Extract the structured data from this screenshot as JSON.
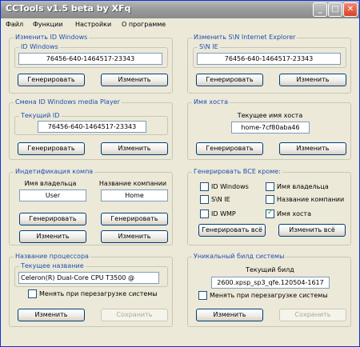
{
  "window": {
    "title": "CCTools v1.5 beta by XFq"
  },
  "titlebar_buttons": {
    "minimize": "_",
    "maximize": "□",
    "close": "✕"
  },
  "menu": [
    "Файл",
    "Функции",
    "Настройки",
    "О программе"
  ],
  "windows_id": {
    "group_title": "Изменить ID Windows",
    "field_label": "ID Windows",
    "value": "76456-640-1464517-23343",
    "generate_label": "Генерировать",
    "change_label": "Изменить"
  },
  "ie": {
    "group_title": "Изменить S\\N Internet Explorer",
    "field_label": "S\\N IE",
    "value": "76456-640-1464517-23343",
    "generate_label": "Генерировать",
    "change_label": "Изменить"
  },
  "media_player": {
    "group_title": "Смена ID Windows media Player",
    "field_label": "Текущий ID",
    "value": "76456-640-1464517-23343",
    "generate_label": "Генерировать",
    "change_label": "Изменить"
  },
  "host": {
    "group_title": "Имя хоста",
    "field_label": "Текущее имя хоста",
    "value": "home-7cf80aba46",
    "generate_label": "Генерировать",
    "change_label": "Изменить"
  },
  "identification": {
    "group_title": "Индетификация компа",
    "owner_label": "Имя владельца",
    "owner_value": "User",
    "company_label": "Название компании",
    "company_value": "Home",
    "generate_owner_label": "Генерировать",
    "change_owner_label": "Изменить",
    "generate_company_label": "Генерировать",
    "change_company_label": "Изменить"
  },
  "generate_all": {
    "group_title": "Генерировать ВСЕ кроме:",
    "options": [
      {
        "label": "ID Windows",
        "checked": false
      },
      {
        "label": "Имя владельца",
        "checked": false
      },
      {
        "label": "S\\N IE",
        "checked": false
      },
      {
        "label": "Название компании",
        "checked": false
      },
      {
        "label": "ID WMP",
        "checked": false
      },
      {
        "label": "Имя хоста",
        "checked": true
      }
    ],
    "generate_all_label": "Генерировать всё",
    "change_all_label": "Изменить всё"
  },
  "processor": {
    "group_title": "Название процессора",
    "field_label": "Текущее название",
    "value": "Celeron(R) Dual-Core CPU       T3500  @",
    "reboot_label": "Менять при перезагрузке системы",
    "change_label": "Изменить",
    "save_label": "Сохранить"
  },
  "build": {
    "group_title": "Уникальный билд системы",
    "field_label": "Текущий билд",
    "value": "2600.xpsp_sp3_qfe.120504-1617",
    "reboot_label": "Менять при перезагрузке системы",
    "change_label": "Изменить",
    "save_label": "Сохранить"
  }
}
